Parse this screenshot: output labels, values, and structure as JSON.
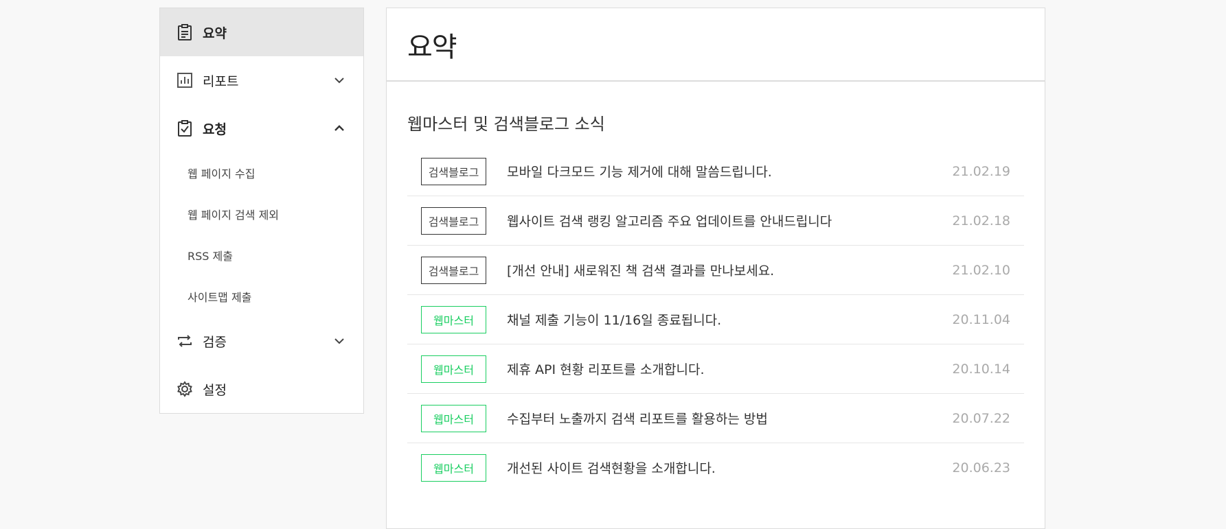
{
  "sidebar": {
    "items": [
      {
        "label": "요약",
        "icon": "clipboard-icon"
      },
      {
        "label": "리포트",
        "icon": "bar-chart-icon"
      },
      {
        "label": "요청",
        "icon": "clipboard-check-icon"
      },
      {
        "label": "검증",
        "icon": "repeat-icon"
      },
      {
        "label": "설정",
        "icon": "gear-icon"
      }
    ],
    "sub_items": [
      {
        "label": "웹 페이지 수집"
      },
      {
        "label": "웹 페이지 검색 제외"
      },
      {
        "label": "RSS 제출"
      },
      {
        "label": "사이트맵 제출"
      }
    ]
  },
  "main": {
    "title": "요약",
    "section_title": "웹마스터 및 검색블로그 소식",
    "news": [
      {
        "badge": "검색블로그",
        "title": "모바일 다크모드 기능 제거에 대해 말씀드립니다.",
        "date": "21.02.19"
      },
      {
        "badge": "검색블로그",
        "title": "웹사이트 검색 랭킹 알고리즘 주요 업데이트를 안내드립니다",
        "date": "21.02.18"
      },
      {
        "badge": "검색블로그",
        "title": "[개선 안내] 새로워진 책 검색 결과를 만나보세요.",
        "date": "21.02.10"
      },
      {
        "badge": "웹마스터",
        "title": "채널 제출 기능이 11/16일 종료됩니다.",
        "date": "20.11.04"
      },
      {
        "badge": "웹마스터",
        "title": "제휴 API 현황 리포트를 소개합니다.",
        "date": "20.10.14"
      },
      {
        "badge": "웹마스터",
        "title": "수집부터 노출까지 검색 리포트를 활용하는 방법",
        "date": "20.07.22"
      },
      {
        "badge": "웹마스터",
        "title": "개선된 사이트 검색현황을 소개합니다.",
        "date": "20.06.23"
      }
    ]
  },
  "colors": {
    "accent_green": "#19ce60",
    "active_bg": "#e6e6e6",
    "border": "#dcdcdc",
    "date_gray": "#aaaaaa"
  }
}
